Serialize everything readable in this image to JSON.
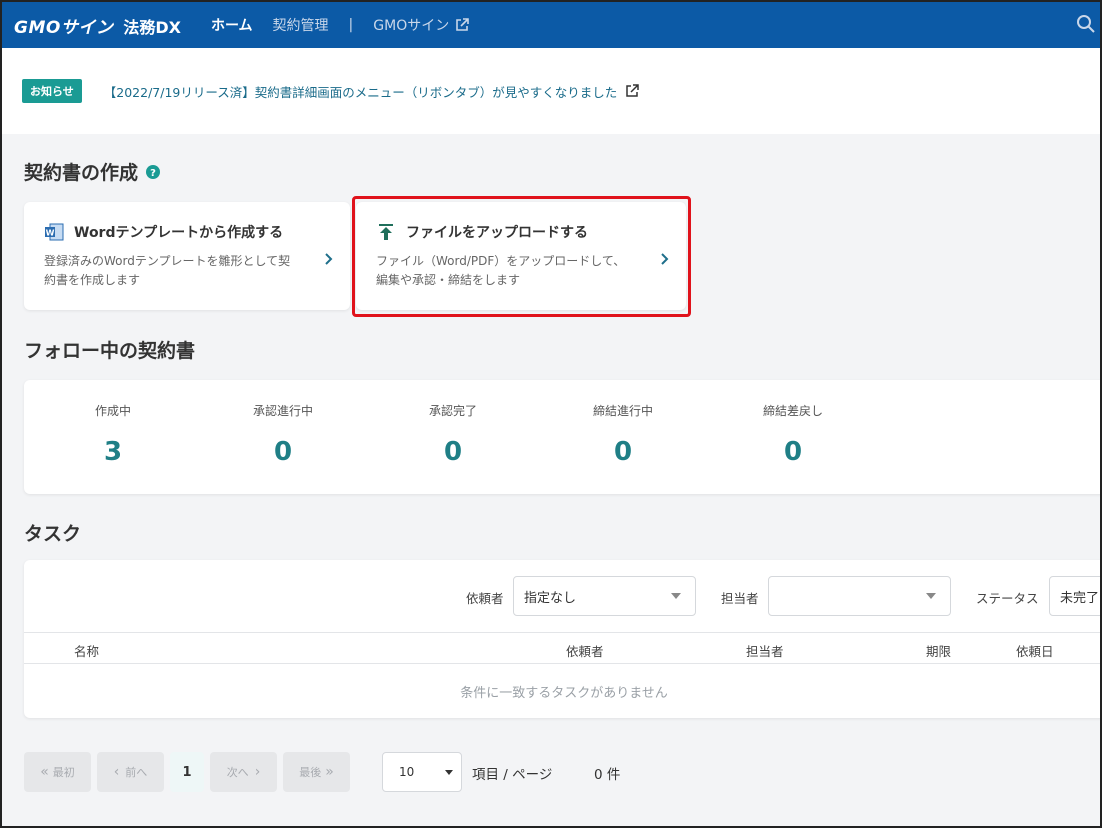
{
  "header": {
    "logo_main": "GMOサイン",
    "logo_sub": "法務DX",
    "nav": [
      {
        "label": "ホーム",
        "active": true
      },
      {
        "label": "契約管理",
        "active": false
      },
      {
        "label": "GMOサイン",
        "active": false
      }
    ],
    "nav_separator": "|",
    "search_icon": "search-icon"
  },
  "notice": {
    "badge": "お知らせ",
    "text": "【2022/7/19リリース済】契約書詳細画面のメニュー（リボンタブ）が見やすくなりました"
  },
  "create": {
    "title": "契約書の作成",
    "cards": [
      {
        "title": "Wordテンプレートから作成する",
        "desc1": "登録済みのWordテンプレートを雛形として契",
        "desc2": "約書を作成します",
        "icon": "word-icon"
      },
      {
        "title": "ファイルをアップロードする",
        "desc1": "ファイル（Word/PDF）をアップロードして、",
        "desc2": "編集や承認・締結をします",
        "icon": "upload-icon"
      }
    ]
  },
  "follow": {
    "title": "フォロー中の契約書",
    "stats": [
      {
        "label": "作成中",
        "value": "3"
      },
      {
        "label": "承認進行中",
        "value": "0"
      },
      {
        "label": "承認完了",
        "value": "0"
      },
      {
        "label": "締結進行中",
        "value": "0"
      },
      {
        "label": "締結差戻し",
        "value": "0"
      }
    ]
  },
  "tasks": {
    "title": "タスク",
    "filters": {
      "requester_label": "依頼者",
      "requester_value": "指定なし",
      "assignee_label": "担当者",
      "assignee_value": "",
      "status_label": "ステータス",
      "status_value": "未完了"
    },
    "columns": [
      "名称",
      "依頼者",
      "担当者",
      "期限",
      "依頼日"
    ],
    "empty_message": "条件に一致するタスクがありません"
  },
  "pagination": {
    "first": "最初",
    "prev": "前へ",
    "current": "1",
    "next": "次へ",
    "last": "最後",
    "per_page": "10",
    "per_page_suffix": "項目 / ページ",
    "count": "0 件"
  },
  "colors": {
    "header_bg": "#0c5aa6",
    "accent": "#1a9b94",
    "stat_value": "#1f7f86",
    "highlight": "#e0121b"
  }
}
